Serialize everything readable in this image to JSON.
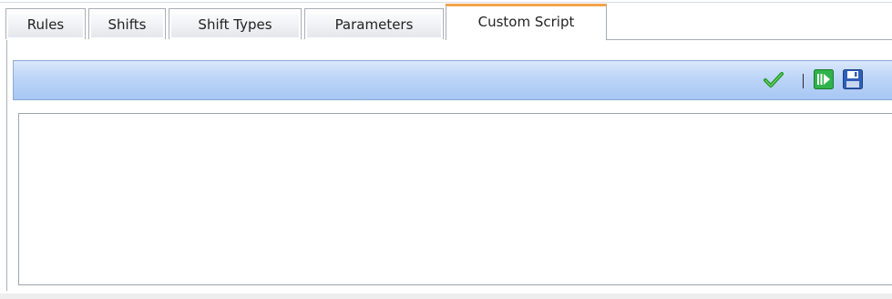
{
  "tabs": [
    {
      "label": "Rules",
      "active": false
    },
    {
      "label": "Shifts",
      "active": false
    },
    {
      "label": "Shift Types",
      "active": false
    },
    {
      "label": "Parameters",
      "active": false
    },
    {
      "label": "Custom Script",
      "active": true
    }
  ],
  "toolbar": {
    "icons": [
      "checkmark-icon",
      "separator",
      "run-script-icon",
      "save-icon"
    ]
  },
  "editor": {
    "value": "",
    "placeholder": ""
  },
  "colors": {
    "active_tab_accent": "#f3a24a",
    "toolbar_gradient_top": "#d9e8fb",
    "toolbar_gradient_bottom": "#a6c6f2",
    "checkmark_green": "#1f9a1f",
    "run_green": "#2fb34a",
    "save_blue": "#2f5fb8"
  }
}
